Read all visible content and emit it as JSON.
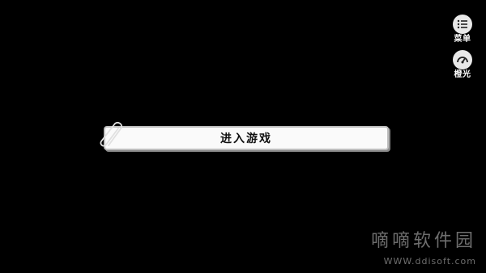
{
  "side_menu": {
    "menu_label": "菜单",
    "light_label": "橙光"
  },
  "main": {
    "enter_game_label": "进入游戏"
  },
  "watermark": {
    "name": "嘀嘀软件园",
    "url": "WWW.ddisoft.com"
  }
}
